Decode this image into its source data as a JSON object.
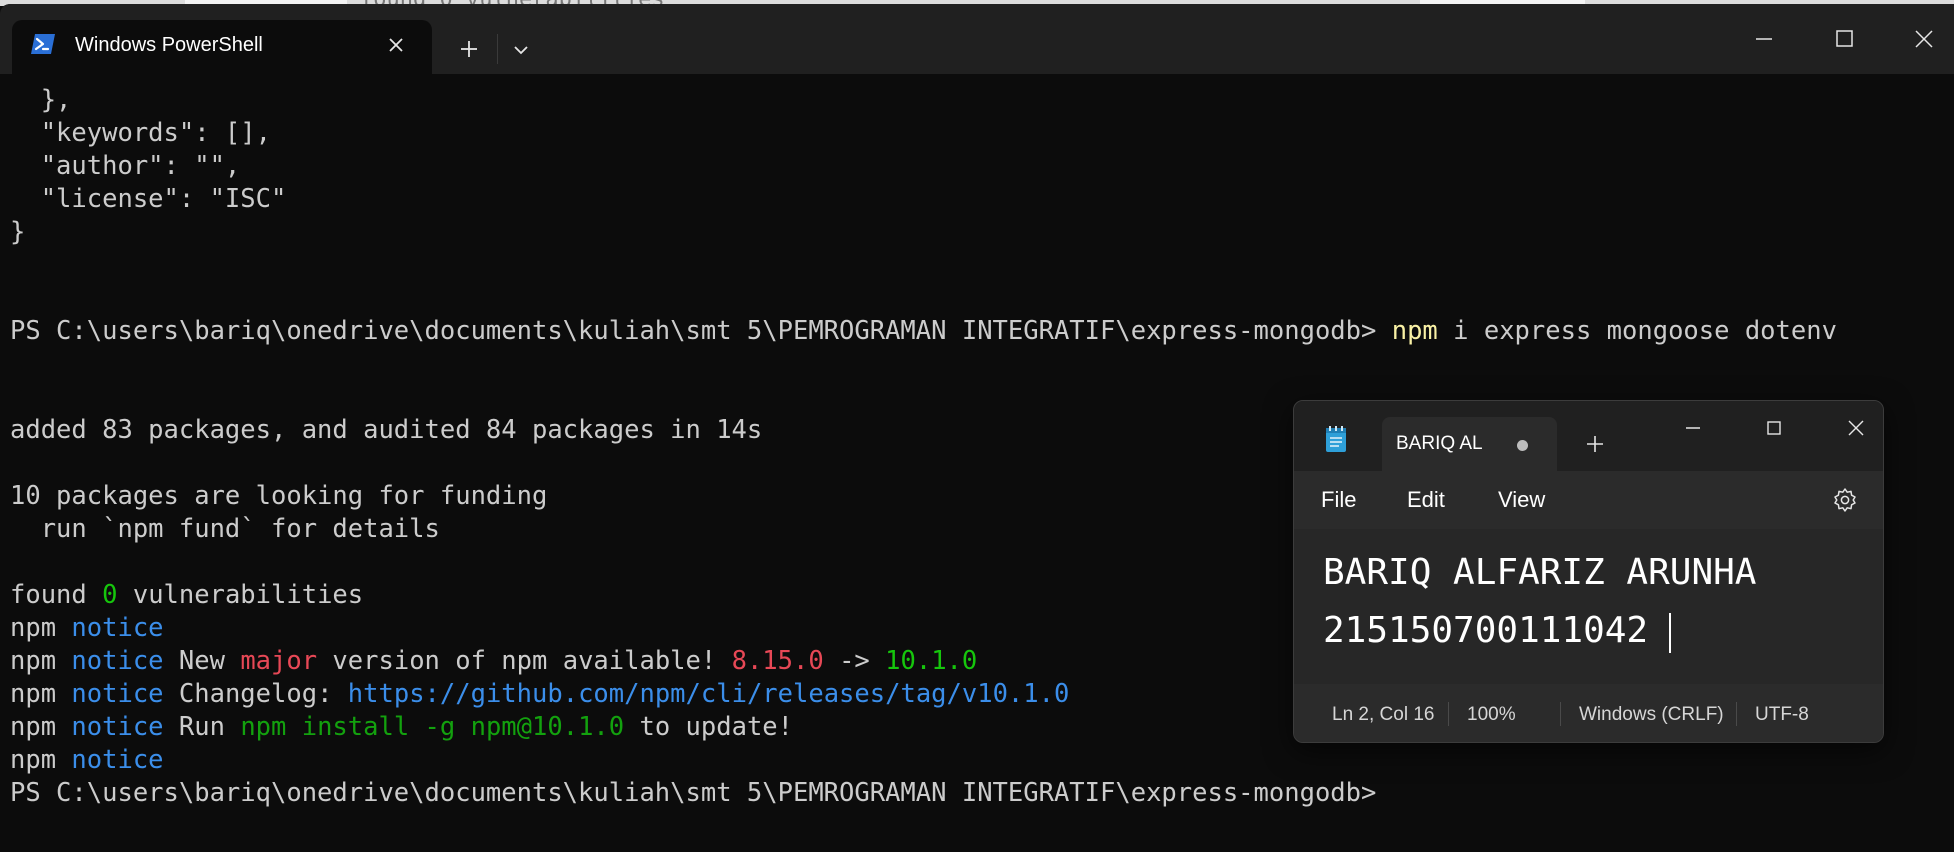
{
  "backdrop": {
    "partial_text": "found 0 vulnerabilities"
  },
  "terminal": {
    "tab_title": "Windows PowerShell",
    "icon": "powershell-icon",
    "lines": [
      [
        {
          "t": "  },",
          "c": ""
        }
      ],
      [
        {
          "t": "  \"keywords\": [],",
          "c": ""
        }
      ],
      [
        {
          "t": "  \"author\": \"\",",
          "c": ""
        }
      ],
      [
        {
          "t": "  \"license\": \"ISC\"",
          "c": ""
        }
      ],
      [
        {
          "t": "}",
          "c": ""
        }
      ],
      [
        {
          "t": "",
          "c": ""
        }
      ],
      [
        {
          "t": "",
          "c": ""
        }
      ],
      [
        {
          "t": "PS C:\\users\\bariq\\onedrive\\documents\\kuliah\\smt 5\\PEMROGRAMAN INTEGRATIF\\express-mongodb> ",
          "c": ""
        },
        {
          "t": "npm",
          "c": "yellow"
        },
        {
          "t": " i express mongoose dotenv",
          "c": ""
        }
      ],
      [
        {
          "t": "",
          "c": ""
        }
      ],
      [
        {
          "t": "",
          "c": ""
        }
      ],
      [
        {
          "t": "added 83 packages, and audited 84 packages in 14s",
          "c": ""
        }
      ],
      [
        {
          "t": "",
          "c": ""
        }
      ],
      [
        {
          "t": "10 packages are looking for funding",
          "c": ""
        }
      ],
      [
        {
          "t": "  run `npm fund` for details",
          "c": ""
        }
      ],
      [
        {
          "t": "",
          "c": ""
        }
      ],
      [
        {
          "t": "found ",
          "c": ""
        },
        {
          "t": "0",
          "c": "green"
        },
        {
          "t": " vulnerabilities",
          "c": ""
        }
      ],
      [
        {
          "t": "npm ",
          "c": ""
        },
        {
          "t": "notice",
          "c": "blue"
        }
      ],
      [
        {
          "t": "npm ",
          "c": ""
        },
        {
          "t": "notice",
          "c": "blue"
        },
        {
          "t": " New ",
          "c": ""
        },
        {
          "t": "major",
          "c": "red"
        },
        {
          "t": " version of npm available! ",
          "c": ""
        },
        {
          "t": "8.15.0",
          "c": "red"
        },
        {
          "t": " -> ",
          "c": ""
        },
        {
          "t": "10.1.0",
          "c": "green"
        }
      ],
      [
        {
          "t": "npm ",
          "c": ""
        },
        {
          "t": "notice",
          "c": "blue"
        },
        {
          "t": " Changelog: ",
          "c": ""
        },
        {
          "t": "https://github.com/npm/cli/releases/tag/v10.1.0",
          "c": "blue"
        }
      ],
      [
        {
          "t": "npm ",
          "c": ""
        },
        {
          "t": "notice",
          "c": "blue"
        },
        {
          "t": " Run ",
          "c": ""
        },
        {
          "t": "npm install -g npm@10.1.0",
          "c": "green2"
        },
        {
          "t": " to update!",
          "c": ""
        }
      ],
      [
        {
          "t": "npm ",
          "c": ""
        },
        {
          "t": "notice",
          "c": "blue"
        }
      ],
      [
        {
          "t": "PS C:\\users\\bariq\\onedrive\\documents\\kuliah\\smt 5\\PEMROGRAMAN INTEGRATIF\\express-mongodb>",
          "c": ""
        }
      ]
    ]
  },
  "notepad": {
    "tab_title": "BARIQ AL",
    "menu": {
      "file": "File",
      "edit": "Edit",
      "view": "View"
    },
    "content": {
      "line1": "BARIQ ALFARIZ ARUNHA",
      "line2": "215150700111042"
    },
    "status": {
      "position": "Ln 2, Col 16",
      "zoom": "100%",
      "line_ending": "Windows (CRLF)",
      "encoding": "UTF-8"
    }
  },
  "colors": {
    "terminal_bg": "#0c0c0c",
    "titlebar_bg": "#202020",
    "yellow": "#f9f1a5",
    "blue": "#3b8eea",
    "red": "#e74856",
    "green": "#16c60c"
  }
}
